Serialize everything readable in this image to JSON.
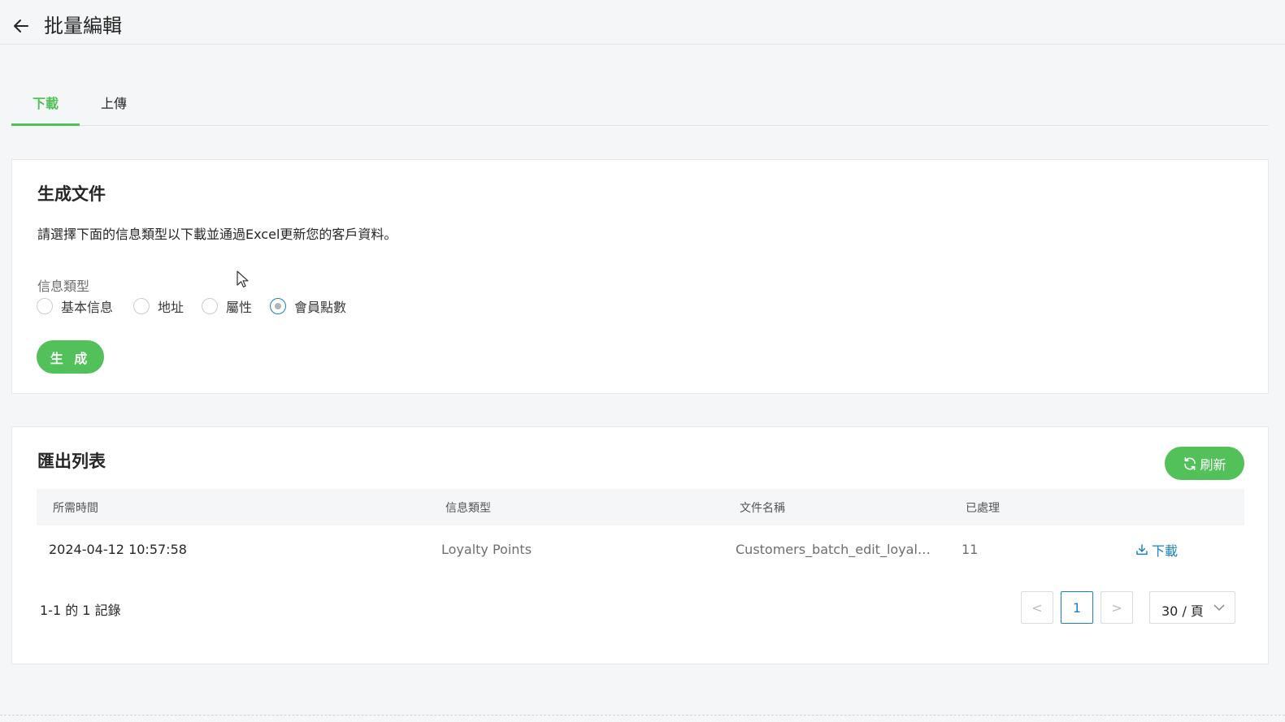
{
  "header": {
    "title": "批量編輯"
  },
  "tabs": [
    {
      "label": "下載",
      "active": true
    },
    {
      "label": "上傳",
      "active": false
    }
  ],
  "generate": {
    "title": "生成文件",
    "description": "請選擇下面的信息類型以下載並通過Excel更新您的客戶資料。",
    "field_label": "信息類型",
    "options": [
      {
        "label": "基本信息",
        "checked": false
      },
      {
        "label": "地址",
        "checked": false
      },
      {
        "label": "屬性",
        "checked": false
      },
      {
        "label": "會員點數",
        "checked": true
      }
    ],
    "button_label": "生 成"
  },
  "export_list": {
    "title": "匯出列表",
    "refresh_label": "刷新",
    "columns": [
      "所需時間",
      "信息類型",
      "文件名稱",
      "已處理"
    ],
    "rows": [
      {
        "time": "2024-04-12 10:57:58",
        "type": "Loyalty Points",
        "file": "Customers_batch_edit_loyalty_points",
        "processed": "11",
        "action": "下載"
      }
    ],
    "record_count": "1-1 的 1 記錄",
    "pagination": {
      "prev": "<",
      "current": "1",
      "next": ">",
      "page_size": "30 / 頁"
    }
  },
  "colors": {
    "accent": "#52c15a",
    "link": "#1c7fc6"
  }
}
